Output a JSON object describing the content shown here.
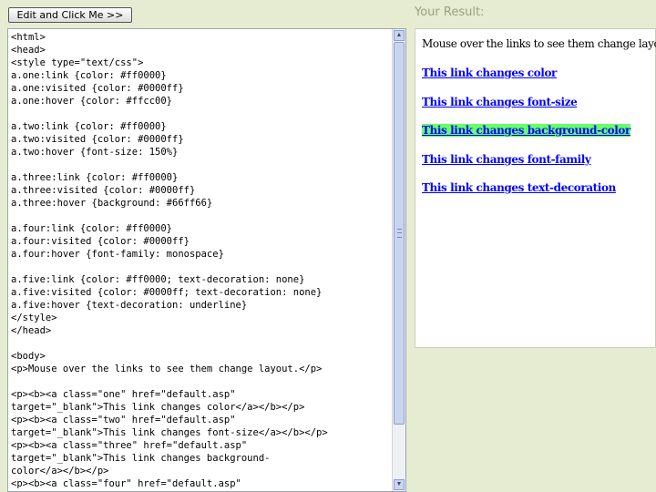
{
  "toolbar": {
    "edit_button_label": "Edit and Click Me >>"
  },
  "result": {
    "title": "Your Result:",
    "intro": "Mouse over the links to see them change layout.",
    "links": [
      "This link changes color",
      "This link changes font-size",
      "This link changes background-color",
      "This link changes font-family",
      "This link changes text-decoration"
    ]
  },
  "editor": {
    "lines": [
      "<html>",
      "<head>",
      "<style type=\"text/css\">",
      "a.one:link {color: #ff0000}",
      "a.one:visited {color: #0000ff}",
      "a.one:hover {color: #ffcc00}",
      "",
      "a.two:link {color: #ff0000}",
      "a.two:visited {color: #0000ff}",
      "a.two:hover {font-size: 150%}",
      "",
      "a.three:link {color: #ff0000}",
      "a.three:visited {color: #0000ff}",
      "a.three:hover {background: #66ff66}",
      "",
      "a.four:link {color: #ff0000}",
      "a.four:visited {color: #0000ff}",
      "a.four:hover {font-family: monospace}",
      "",
      "a.five:link {color: #ff0000; text-decoration: none}",
      "a.five:visited {color: #0000ff; text-decoration: none}",
      "a.five:hover {text-decoration: underline}",
      "</style>",
      "</head>",
      "",
      "<body>",
      "<p>Mouse over the links to see them change layout.</p>",
      "",
      "<p><b><a class=\"one\" href=\"default.asp\"",
      "target=\"_blank\">This link changes color</a></b></p>",
      "<p><b><a class=\"two\" href=\"default.asp\"",
      "target=\"_blank\">This link changes font-size</a></b></p>",
      "<p><b><a class=\"three\" href=\"default.asp\"",
      "target=\"_blank\">This link changes background-",
      "color</a></b></p>",
      "<p><b><a class=\"four\" href=\"default.asp\""
    ]
  },
  "colors": {
    "page_bg": "#e5ecd2",
    "title_text": "#9aa37a",
    "link": "#0000ff",
    "highlight": "#66ff66"
  }
}
